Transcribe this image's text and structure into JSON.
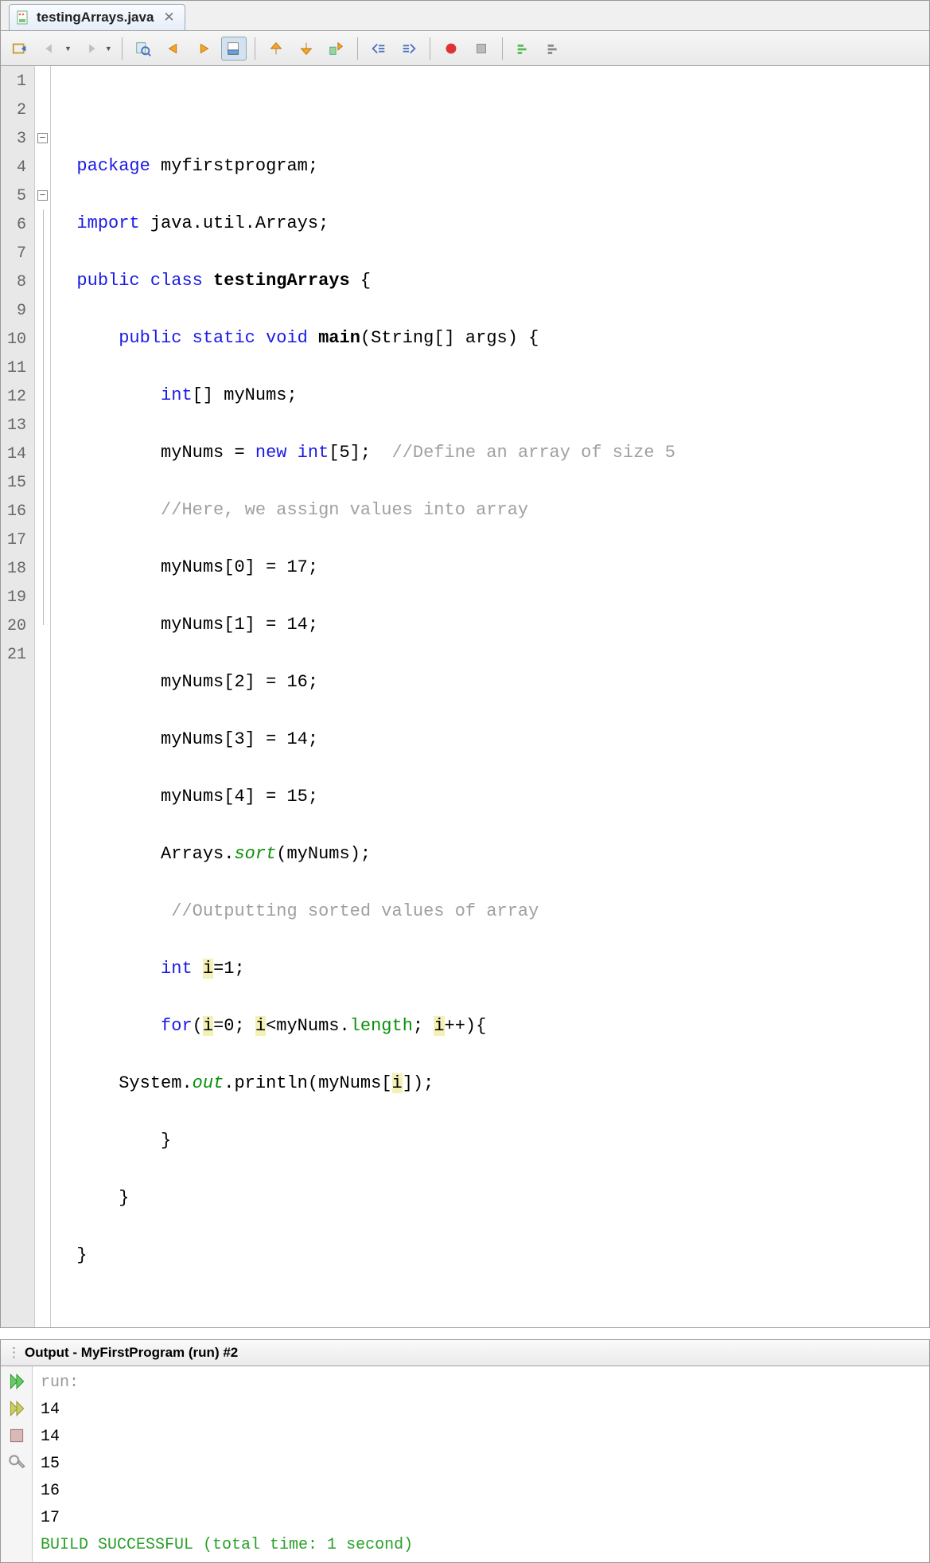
{
  "tab": {
    "filename": "testingArrays.java",
    "close": "✕"
  },
  "gutter": {
    "start": 1,
    "end": 21
  },
  "code": {
    "l1": "",
    "l2a": "package",
    "l2b": " myfirstprogram;",
    "l3a": "import",
    "l3b": " java.util.Arrays;",
    "l4a": "public",
    "l4b": " class",
    "l4c": " testingArrays",
    "l4d": " {",
    "l5a": "public",
    "l5b": " static",
    "l5c": " void",
    "l5d": " main",
    "l5e": "(String[] args) {",
    "l6a": "int",
    "l6b": "[] myNums;",
    "l7a": "myNums = ",
    "l7b": "new",
    "l7c": " int",
    "l7d": "[5];  ",
    "l7e": "//Define an array of size 5",
    "l8": "//Here, we assign values into array",
    "l9": "myNums[0] = 17;",
    "l10": "myNums[1] = 14;",
    "l11": "myNums[2] = 16;",
    "l12": "myNums[3] = 14;",
    "l13": "myNums[4] = 15;",
    "l14a": "Arrays.",
    "l14b": "sort",
    "l14c": "(myNums);",
    "l15": "//Outputting sorted values of array",
    "l16a": "int",
    "l16b": " ",
    "l16c": "i",
    "l16d": "=1;",
    "l17a": "for",
    "l17b": "(",
    "l17c": "i",
    "l17d": "=0; ",
    "l17e": "i",
    "l17f": "<myNums.",
    "l17g": "length",
    "l17h": "; ",
    "l17i": "i",
    "l17j": "++){",
    "l18a": "System.",
    "l18b": "out",
    "l18c": ".println(myNums[",
    "l18d": "i",
    "l18e": "]);",
    "l19": "}",
    "l20": "}",
    "l21": "}"
  },
  "output": {
    "title": "Output - MyFirstProgram (run) #2",
    "run": "run:",
    "lines": [
      "14",
      "14",
      "15",
      "16",
      "17"
    ],
    "success": "BUILD SUCCESSFUL (total time: 1 second)"
  }
}
